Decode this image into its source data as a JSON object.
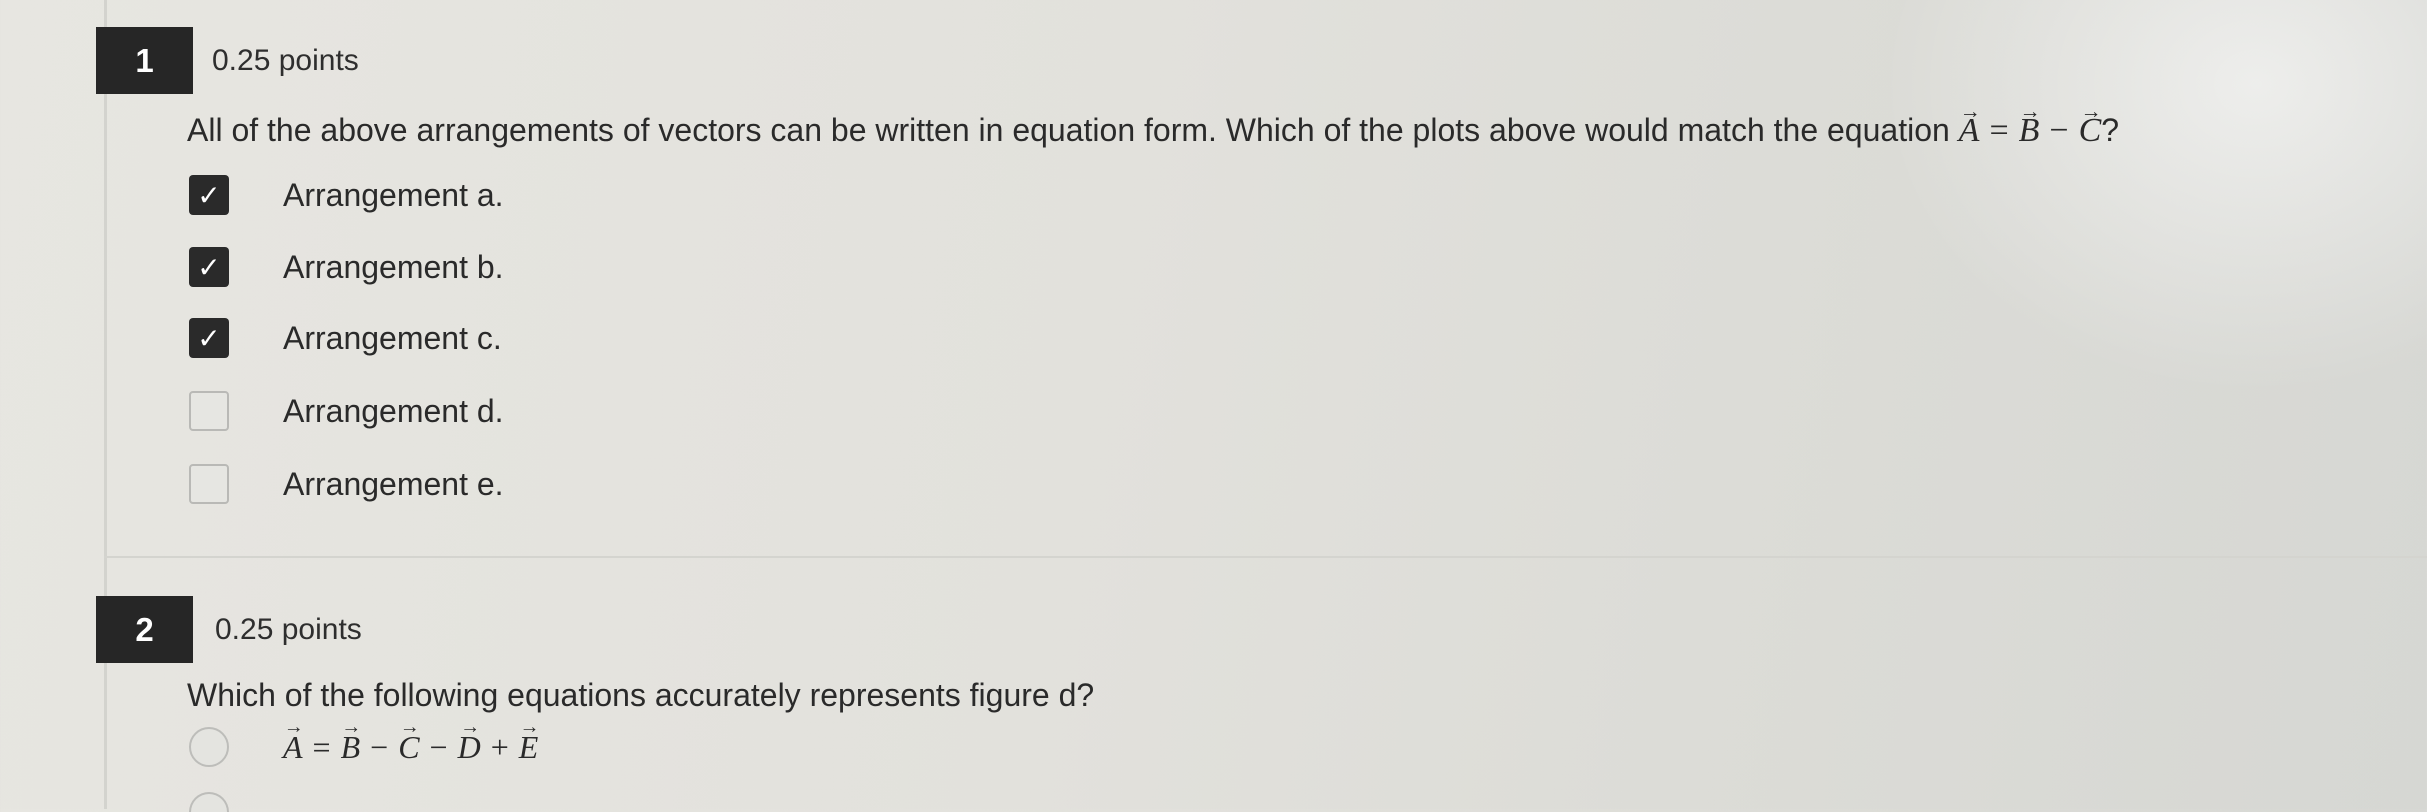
{
  "questions": [
    {
      "number": "1",
      "points": "0.25 points",
      "prompt": "All of the above arrangements of vectors can be written in equation form. Which of the plots above would match the equation",
      "equation": {
        "lhs": "A",
        "eq": "=",
        "t1": "B",
        "op1": "−",
        "t2": "C",
        "suffix": "?"
      },
      "options": [
        {
          "label": "Arrangement a.",
          "checked": true
        },
        {
          "label": "Arrangement b.",
          "checked": true
        },
        {
          "label": "Arrangement c.",
          "checked": true
        },
        {
          "label": "Arrangement d.",
          "checked": false
        },
        {
          "label": "Arrangement e.",
          "checked": false
        }
      ]
    },
    {
      "number": "2",
      "points": "0.25 points",
      "prompt": "Which of the following equations accurately represents figure d?",
      "options": [
        {
          "lhs": "A",
          "eq": "=",
          "t1": "B",
          "op1": "−",
          "t2": "C",
          "op2": "−",
          "t3": "D",
          "op3": "+",
          "t4": "E",
          "selected": false
        }
      ]
    }
  ],
  "icons": {
    "checked": "checkmark-icon"
  },
  "colors": {
    "badge": "#262626",
    "checkbox_checked": "#2a2a2a",
    "checkbox_unchecked_border": "#b9b9b6"
  }
}
